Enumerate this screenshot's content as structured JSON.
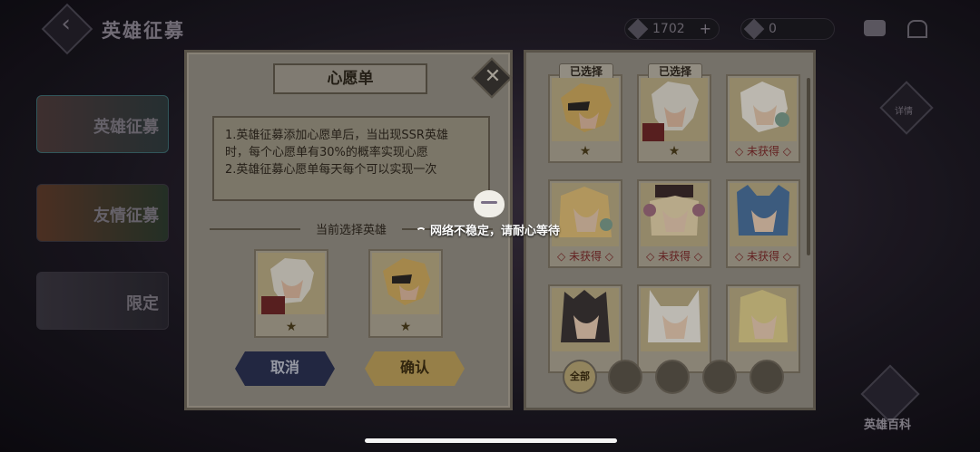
{
  "header": {
    "title": "英雄征募",
    "resource_gems": "1702",
    "resource_plus": "+",
    "resource_tickets": "0"
  },
  "sidebar": {
    "items": [
      {
        "label": "英雄征募"
      },
      {
        "label": "友情征募"
      },
      {
        "label": "限定"
      }
    ]
  },
  "right_deco_label": "详情",
  "hero_book_label": "英雄百科",
  "wishlist": {
    "title": "心愿单",
    "rules": [
      "1.英雄征募添加心愿单后，当出现SSR英雄",
      "时，每个心愿单有30%的概率实现心愿",
      "2.英雄征募心愿单每天每个可以实现一次"
    ],
    "current_label": "当前选择英雄",
    "selected": [
      {
        "star": "★"
      },
      {
        "star": "★"
      }
    ],
    "cancel_label": "取消",
    "confirm_label": "确认"
  },
  "hero_grid": {
    "selected_tag": "已选择",
    "heroes": [
      {
        "status": "★",
        "selected": true
      },
      {
        "status": "★",
        "selected": true
      },
      {
        "status": "◇ 未获得 ◇",
        "selected": false
      },
      {
        "status": "◇ 未获得 ◇",
        "selected": false
      },
      {
        "status": "◇ 未获得 ◇",
        "selected": false
      },
      {
        "status": "◇ 未获得 ◇",
        "selected": false
      },
      {
        "status": "",
        "selected": false
      },
      {
        "status": "",
        "selected": false
      },
      {
        "status": "",
        "selected": false
      }
    ],
    "filters": [
      {
        "label": "全部",
        "active": true
      },
      {
        "label": "",
        "active": false
      },
      {
        "label": "",
        "active": false
      },
      {
        "label": "",
        "active": false
      },
      {
        "label": "",
        "active": false
      }
    ]
  },
  "toast": {
    "text": "网络不稳定，请耐心等待"
  },
  "colors": {
    "panel_bg": "#8f8a80",
    "cancel_btn": "#2a3050",
    "confirm_btn": "#b79b58",
    "not_owned_text": "#7a2a2a"
  }
}
